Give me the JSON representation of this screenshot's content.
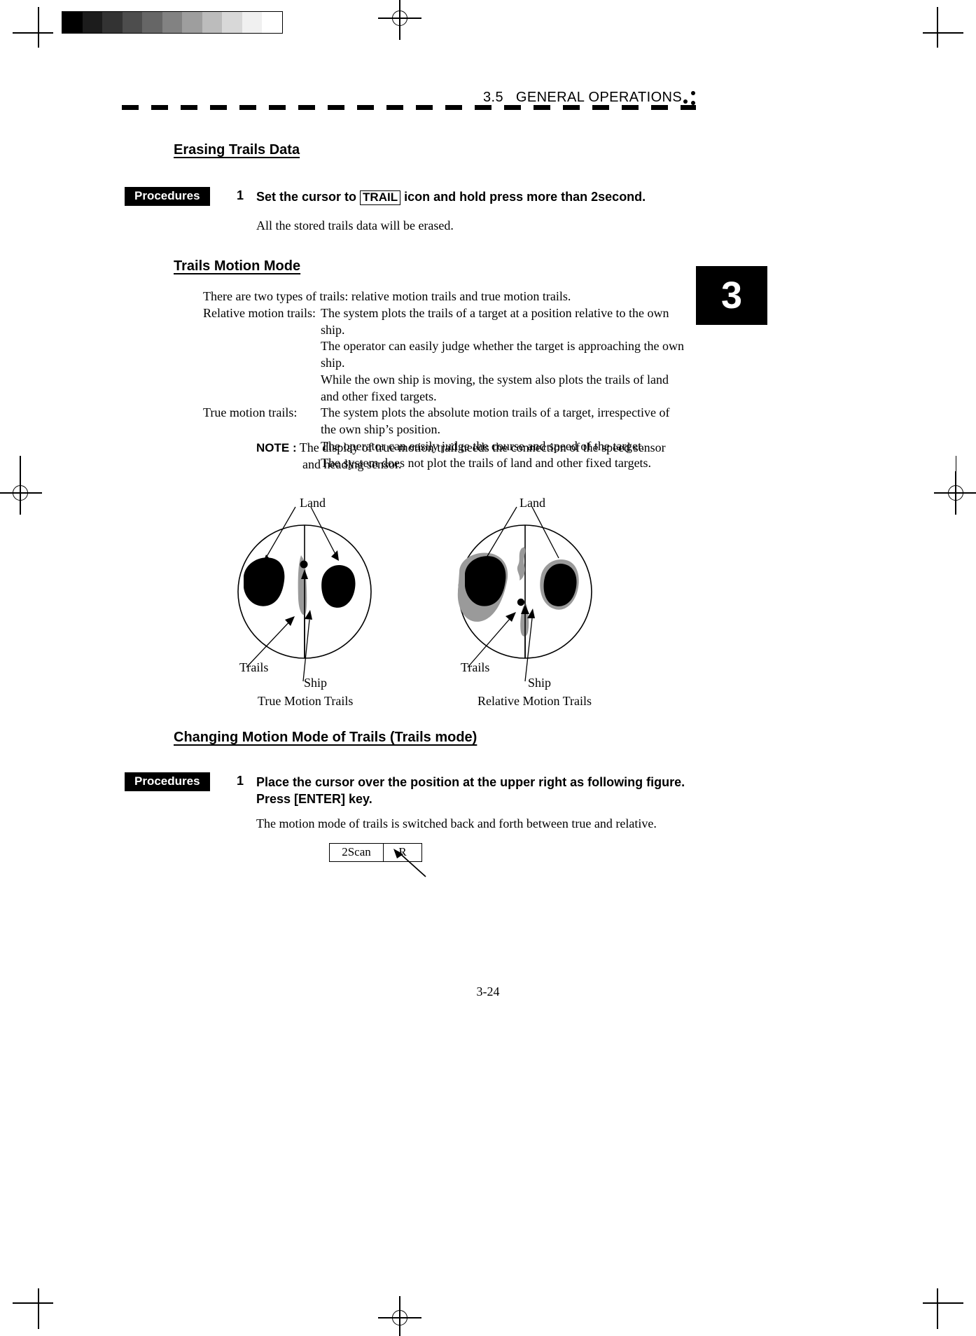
{
  "header": {
    "section_number": "3.5",
    "section_title": "GENERAL  OPERATIONS",
    "chapter_tab": "3"
  },
  "sections": {
    "erasing": {
      "heading": "Erasing Trails Data",
      "procedures_label": "Procedures",
      "step_number": "1",
      "step_text_before": "Set the cursor to",
      "step_keycap": "TRAIL",
      "step_text_after": "icon and hold press more than 2second.",
      "result_text": "All the stored trails data will be erased."
    },
    "trails_motion_mode": {
      "heading": "Trails Motion Mode",
      "lead": "There are two types of trails: relative motion trails and true motion trails.",
      "definitions": [
        {
          "term": "Relative motion trails:",
          "lines": [
            "The system plots the trails of a target at a position relative to the own ship.",
            "The operator can easily judge whether the target is approaching the own ship.",
            "While the own ship is moving, the system also plots the trails of land and other fixed targets."
          ]
        },
        {
          "term": "True motion trails:",
          "lines": [
            "The system plots the absolute motion trails of a target, irrespective of the own ship’s position.",
            "The operator can easily judge the course and speed of the target.",
            "The system does not plot the trails of land and other fixed targets."
          ]
        }
      ],
      "note_label": "NOTE :",
      "note_line1": "The display of true motion trail needs the connection of the speed sensor",
      "note_line2": "and heading sensor."
    },
    "figures": {
      "left": {
        "label_land": "Land",
        "label_trails": "Trails",
        "label_ship": "Ship",
        "caption": "True Motion Trails"
      },
      "right": {
        "label_land": "Land",
        "label_trails": "Trails",
        "label_ship": "Ship",
        "caption": "Relative Motion Trails"
      }
    },
    "changing_mode": {
      "heading": "Changing Motion Mode of Trails (Trails mode)",
      "procedures_label": "Procedures",
      "step_number": "1",
      "step_line1": "Place the cursor over the position at the upper right as following figure.",
      "step_line2": "Press [ENTER] key.",
      "result_text": "The motion mode of trails is switched back and forth between true and relative.",
      "scan_box_left": "2Scan",
      "scan_box_right": "R"
    }
  },
  "footer": {
    "page_number": "3-24"
  },
  "greyscale_steps": [
    "#000000",
    "#1c1c1c",
    "#333333",
    "#4d4d4d",
    "#666666",
    "#828282",
    "#9e9e9e",
    "#bcbcbc",
    "#d8d8d8",
    "#f0f0f0",
    "#ffffff"
  ]
}
